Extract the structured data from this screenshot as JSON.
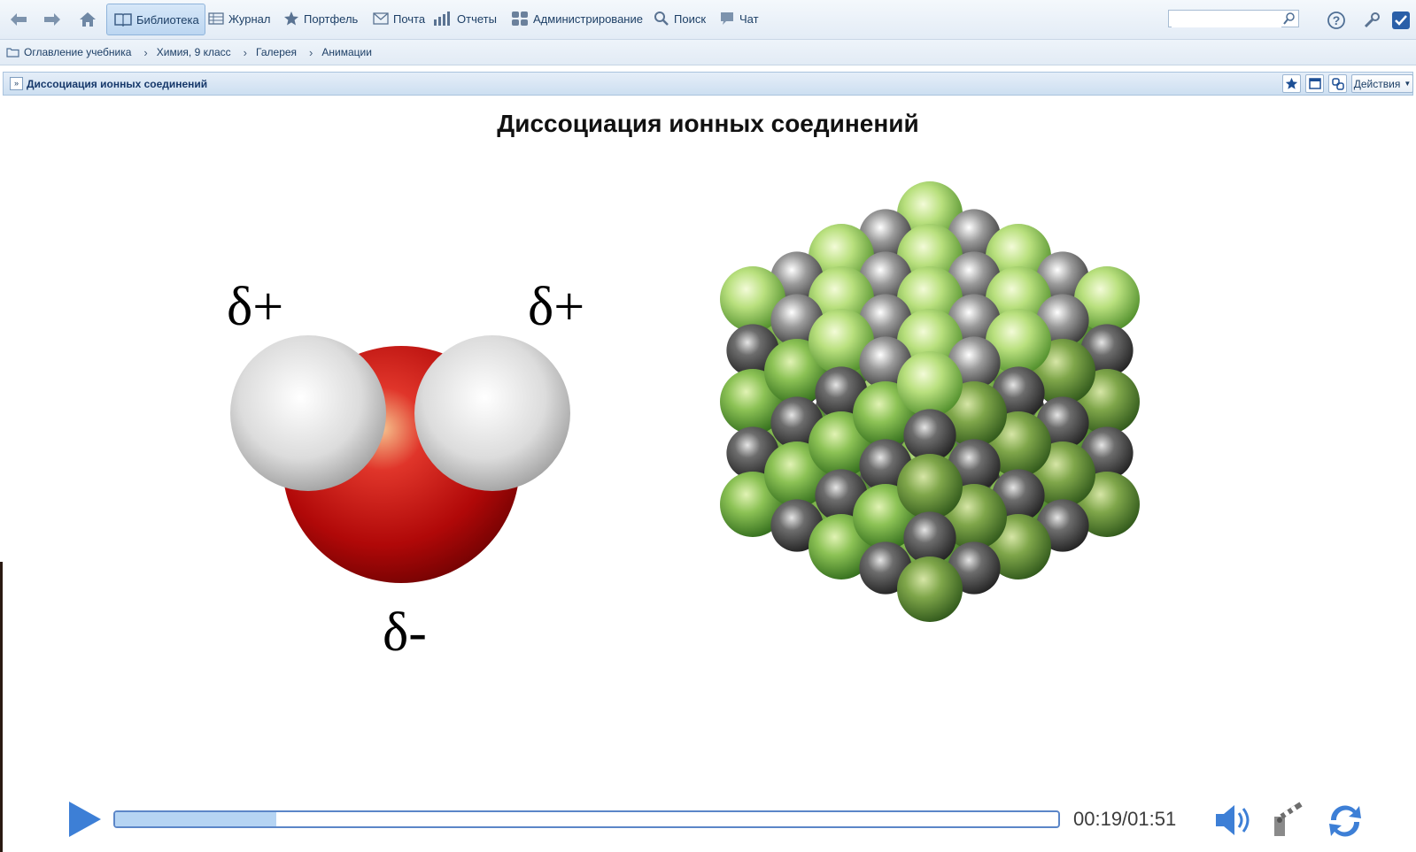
{
  "toolbar": {
    "items": [
      {
        "label": "Библиотека",
        "icon": "book-icon",
        "active": true
      },
      {
        "label": "Журнал",
        "icon": "table-icon"
      },
      {
        "label": "Портфель",
        "icon": "star-icon"
      },
      {
        "label": "Почта",
        "icon": "mail-icon"
      },
      {
        "label": "Отчеты",
        "icon": "bar-chart-icon"
      },
      {
        "label": "Администрирование",
        "icon": "users-icon"
      },
      {
        "label": "Поиск",
        "icon": "magnifier-icon"
      },
      {
        "label": "Чат",
        "icon": "chat-bubble-icon"
      }
    ],
    "search": {
      "value": "",
      "placeholder": ""
    }
  },
  "breadcrumb": [
    "Оглавление учебника",
    "Химия, 9 класс",
    "Галерея",
    "Анимации"
  ],
  "panel": {
    "title": "Диссоциация ионных соединений",
    "actions_label": "Действия"
  },
  "animation": {
    "title": "Диссоциация ионных соединений",
    "labels": {
      "hydrogen_left": "δ+",
      "hydrogen_right": "δ+",
      "oxygen": "δ-"
    },
    "colors": {
      "oxygen": "#c0120a",
      "hydrogen": "#d8d8d8",
      "ion_light_green": "#9ed06a",
      "ion_gray": "#5a5a5a"
    }
  },
  "player": {
    "time": "00:19/01:51",
    "progress": 0.171
  }
}
